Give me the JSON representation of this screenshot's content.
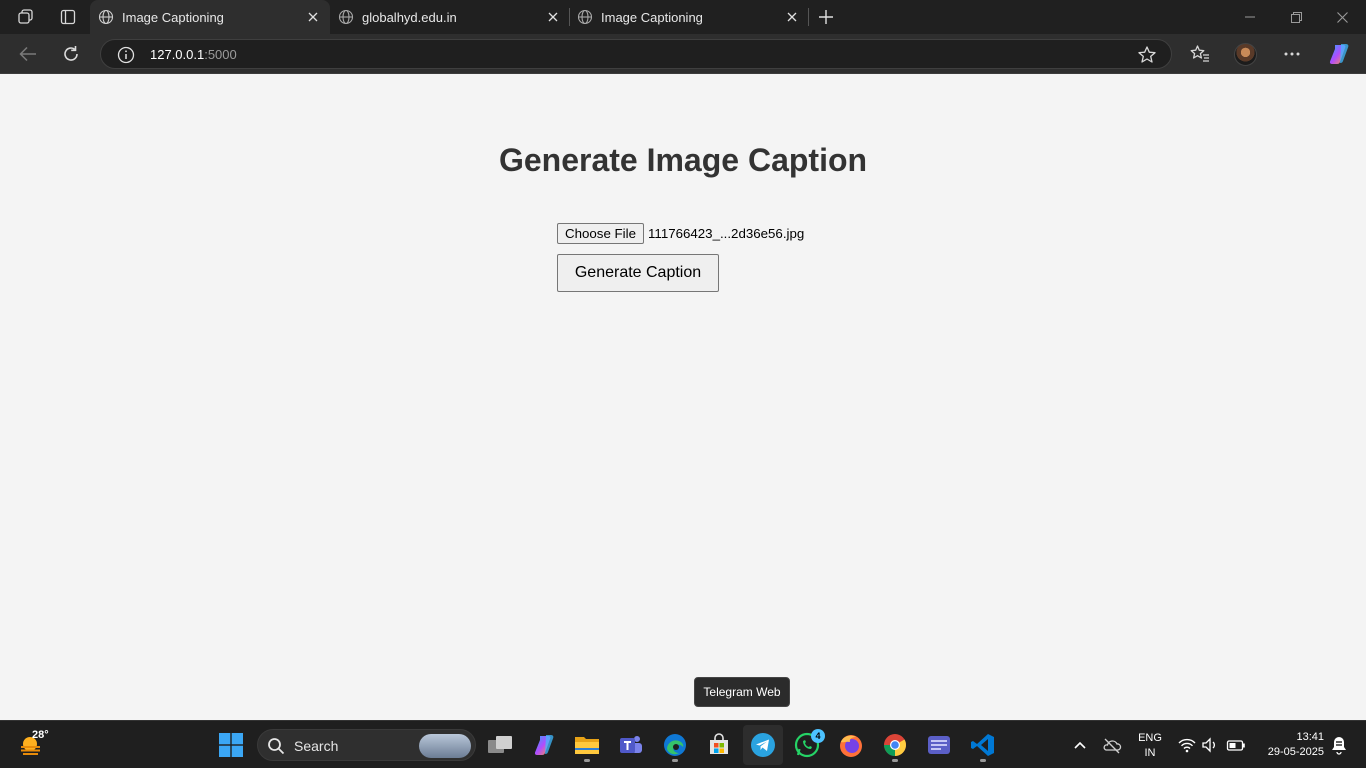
{
  "browser": {
    "tabs": [
      {
        "title": "Image Captioning",
        "active": true
      },
      {
        "title": "globalhyd.edu.in",
        "active": false
      },
      {
        "title": "Image Captioning",
        "active": false
      }
    ],
    "address": {
      "host": "127.0.0.1",
      "port": ":5000"
    }
  },
  "page": {
    "title": "Generate Image Caption",
    "choose_file_label": "Choose File",
    "file_name": "111766423_...2d36e56.jpg",
    "generate_button_label": "Generate Caption"
  },
  "tooltip": {
    "text": "Telegram Web"
  },
  "taskbar": {
    "weather_temp": "28°",
    "search_label": "Search",
    "whatsapp_badge": "4",
    "lang_line1": "ENG",
    "lang_line2": "IN",
    "time": "13:41",
    "date": "29-05-2025",
    "apps": [
      "task-view",
      "copilot",
      "file-explorer",
      "teams",
      "edge",
      "microsoft-store",
      "telegram",
      "whatsapp",
      "firefox",
      "chrome",
      "app",
      "vscode"
    ]
  },
  "colors": {
    "page_bg": "#f4f4f4",
    "title_text": "#333333",
    "chrome_dark": "#202020",
    "toolbar": "#2e2e2e"
  }
}
